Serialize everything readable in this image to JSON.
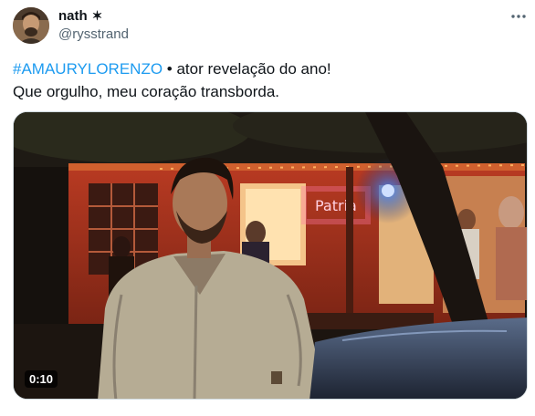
{
  "author": {
    "display_name": "nath",
    "name_emoji": "✶",
    "handle": "@rysstrand"
  },
  "post": {
    "hashtag": "#AMAURYLORENZO",
    "line1_rest": " • ator revelação do ano!",
    "line2": "Que orgulho, meu coração transborda."
  },
  "video": {
    "duration": "0:10",
    "neon_sign": "Patria"
  },
  "colors": {
    "link": "#1d9bf0",
    "secondary_text": "#536471",
    "text": "#0f1419"
  }
}
